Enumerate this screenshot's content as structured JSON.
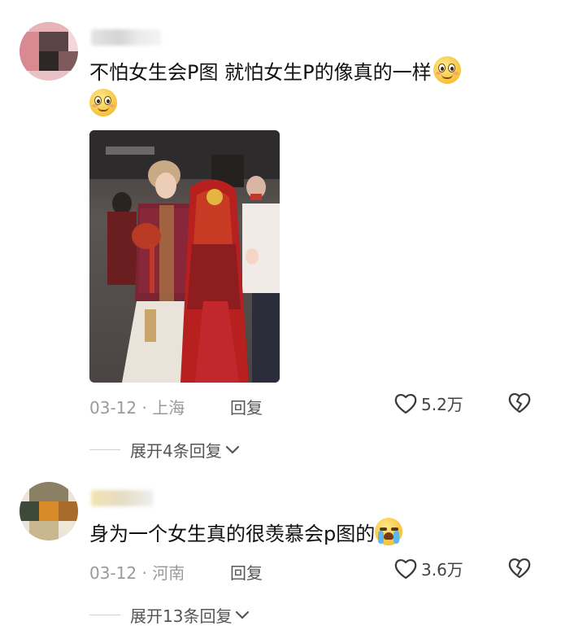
{
  "comments": [
    {
      "text": "不怕女生会P图  就怕女生P的像真的一样",
      "emoji": "smile-emoji",
      "date": "03-12",
      "location": "上海",
      "reply_label": "回复",
      "likes": "5.2万",
      "expand_label": "展开4条回复"
    },
    {
      "text": "身为一个女生真的很羡慕会p图的",
      "emoji": "crying-emoji",
      "date": "03-12",
      "location": "河南",
      "reply_label": "回复",
      "likes": "3.6万",
      "expand_label": "展开13条回复"
    }
  ],
  "separator": "·",
  "icons": {
    "like": "heart-outline-icon",
    "dislike": "broken-heart-icon",
    "expand": "chevron-down-icon"
  },
  "colors": {
    "meta": "#9a9a9a",
    "text": "#111111",
    "action": "#555555"
  }
}
